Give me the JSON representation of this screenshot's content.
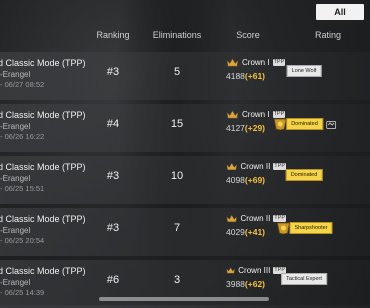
{
  "filter": {
    "label": "All"
  },
  "columns": {
    "ranking": "Ranking",
    "eliminations": "Eliminations",
    "score": "Score",
    "rating": "Rating"
  },
  "colors": {
    "delta": "#f3c13a",
    "gold_badge": "#f3d44a"
  },
  "matches": [
    {
      "mode": "d Classic Mode (TPP)",
      "map": "-Erangel",
      "date": "- 06/27 08:52",
      "ranking": "#3",
      "eliminations": "5",
      "tier": "Crown I",
      "score": "4188",
      "delta": "(+61)",
      "rating": "Lone Wolf",
      "gold": false,
      "medal": false,
      "camera": false
    },
    {
      "mode": "d Classic Mode (TPP)",
      "map": "-Erangel",
      "date": "- 06/26 16:22",
      "ranking": "#4",
      "eliminations": "15",
      "tier": "Crown I",
      "score": "4127",
      "delta": "(+29)",
      "rating": "Dominated",
      "gold": true,
      "medal": true,
      "camera": true
    },
    {
      "mode": "d Classic Mode (TPP)",
      "map": "-Erangel",
      "date": "- 06/25 15:51",
      "ranking": "#3",
      "eliminations": "10",
      "tier": "Crown II",
      "score": "4098",
      "delta": "(+69)",
      "rating": "Dominated",
      "gold": true,
      "medal": false,
      "camera": false
    },
    {
      "mode": "d Classic Mode (TPP)",
      "map": "-Erangel",
      "date": "- 06/25 20:54",
      "ranking": "#3",
      "eliminations": "7",
      "tier": "Crown II",
      "score": "4029",
      "delta": "(+41)",
      "rating": "Sharpshooter",
      "gold": true,
      "medal": true,
      "camera": false
    },
    {
      "mode": "d Classic Mode (TPP)",
      "map": "-Erangel",
      "date": "- 06/25 14:39",
      "ranking": "#6",
      "eliminations": "3",
      "tier": "Crown III",
      "score": "3988",
      "delta": "(+62)",
      "rating": "Tactical Expert",
      "gold": false,
      "medal": false,
      "camera": false
    }
  ]
}
